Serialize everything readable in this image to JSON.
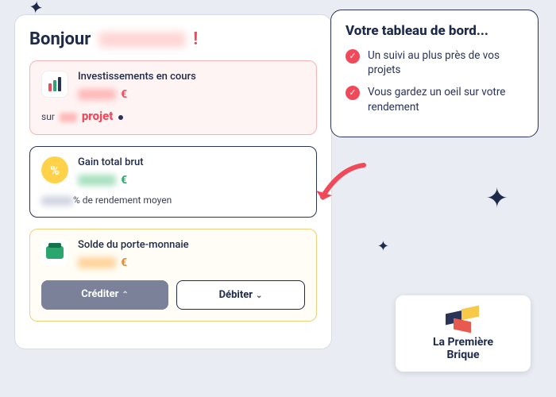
{
  "greeting": {
    "prefix": "Bonjour",
    "exclaim": "!"
  },
  "invest": {
    "title": "Investissements en cours",
    "currency": "€",
    "sub_prefix": "sur",
    "sub_word": "projet"
  },
  "gain": {
    "title": "Gain total brut",
    "currency": "€",
    "yield_suffix": "% de rendement moyen"
  },
  "wallet": {
    "title": "Solde du porte-monnaie",
    "currency": "€",
    "credit_label": "Créditer",
    "debit_label": "Débiter"
  },
  "callout": {
    "title": "Votre tableau de bord...",
    "items": [
      "Un suivi au plus près de vos projets",
      "Vous gardez un oeil sur votre rendement"
    ]
  },
  "brand": {
    "line1": "La Première",
    "line2": "Brique"
  }
}
